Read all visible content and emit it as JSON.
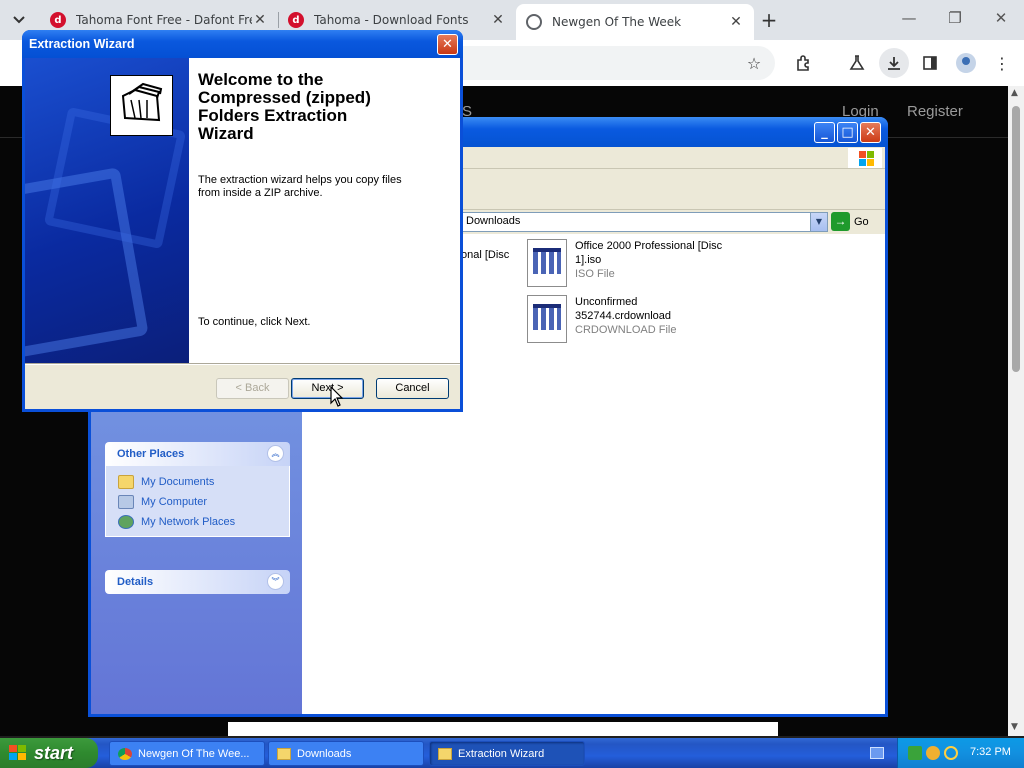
{
  "browser": {
    "tabs": [
      {
        "title": "Tahoma Font Free - Dafont Free",
        "favicon": "d"
      },
      {
        "title": "Tahoma - Download Fonts",
        "favicon": "d"
      },
      {
        "title": "Newgen Of The Week",
        "favicon": "globe-icon"
      }
    ],
    "new_tab": "+",
    "window_controls": {
      "minimize": "—",
      "restore": "❐",
      "close": "✕"
    },
    "toolbar_icons": [
      "star-icon",
      "extensions-icon",
      "labs-icon",
      "download-icon",
      "side-panel-icon",
      "profile-icon",
      "menu-icon"
    ]
  },
  "website": {
    "nav_partial": "S",
    "login": "Login",
    "register": "Register"
  },
  "explorer": {
    "address": "Downloads",
    "go_label": "Go",
    "partial_file": "onal [Disc",
    "other_places": {
      "title": "Other Places",
      "items": [
        "My Documents",
        "My Computer",
        "My Network Places"
      ]
    },
    "details": {
      "title": "Details"
    },
    "files": [
      {
        "name_line1": "Office 2000 Professional [Disc",
        "name_line2": "1].iso",
        "type": "ISO File"
      },
      {
        "name_line1": "Unconfirmed",
        "name_line2": "352744.crdownload",
        "type": "CRDOWNLOAD File"
      }
    ]
  },
  "wizard": {
    "title": "Extraction Wizard",
    "heading_lines": [
      "Welcome to the",
      "Compressed (zipped)",
      "Folders Extraction",
      "Wizard"
    ],
    "description_lines": [
      "The extraction wizard helps you copy files",
      "from inside a ZIP archive."
    ],
    "continue_text": "To continue, click Next.",
    "buttons": {
      "back": "< Back",
      "next": "Next >",
      "cancel": "Cancel"
    }
  },
  "taskbar": {
    "start_label": "start",
    "items": [
      {
        "label": "Newgen Of The Wee...",
        "active": false
      },
      {
        "label": "Downloads",
        "active": false
      },
      {
        "label": "Extraction Wizard",
        "active": true
      }
    ],
    "clock": "7:32 PM"
  },
  "colors": {
    "xp_blue": "#0a50d8",
    "taskbar_green": "#3c9a3c",
    "link_blue": "#215dc6"
  }
}
